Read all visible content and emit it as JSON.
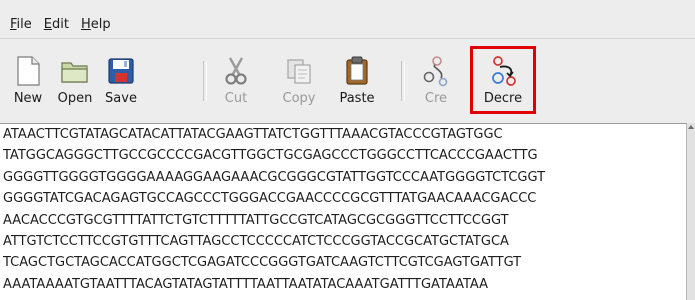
{
  "menu": {
    "file": {
      "mnemonic": "F",
      "rest": "ile"
    },
    "edit": {
      "mnemonic": "E",
      "rest": "dit"
    },
    "help": {
      "mnemonic": "H",
      "rest": "elp"
    }
  },
  "toolbar": {
    "buttons": [
      {
        "label": "New",
        "icon": "new-document-icon",
        "enabled": true
      },
      {
        "label": "Open",
        "icon": "open-folder-icon",
        "enabled": true
      },
      {
        "label": "Save",
        "icon": "floppy-disk-icon",
        "enabled": true
      },
      {
        "label": "Cut",
        "icon": "scissors-icon",
        "enabled": false
      },
      {
        "label": "Copy",
        "icon": "copy-pages-icon",
        "enabled": false
      },
      {
        "label": "Paste",
        "icon": "clipboard-icon",
        "enabled": true
      },
      {
        "label": "Cre",
        "icon": "circles-connect-icon",
        "enabled": false
      },
      {
        "label": "Decre",
        "icon": "circles-arrow-icon",
        "enabled": true,
        "highlighted": true
      }
    ]
  },
  "colors": {
    "highlight": "#e00000",
    "accent_blue": "#3a7bd5",
    "accent_red": "#d23232"
  },
  "sequence": {
    "lines": [
      "ATAACTTCGTATAGCATACATTATACGAAGTTATCTGGTTTAAACGTACCCGTAGTGGC",
      "TATGGCAGGGCTTGCCGCCCCGACGTTGGCTGCGAGCCCTGGGCCTTCACCCGAACTTG",
      "GGGGTTGGGGTGGGGAAAAGGAAGAAACGCGGGCGTATTGGTCCCAATGGGGTCTCGGT",
      "GGGGTATCGACAGAGTGCCAGCCCTGGGACCGAACCCCGCGTTTATGAACAAACGACCC",
      "AACACCCGTGCGTTTTATTCTGTCTTTTTATTGCCGTCATAGCGCGGGTTCCTTCCGGT",
      "ATTGTCTCCTTCCGTGTTTCAGTTAGCCTCCCCCATCTCCCGGTACCGCATGCTATGCA",
      "TCAGCTGCTAGCACCATGGCTCGAGATCCCGGGTGATCAAGTCTTCGTCGAGTGATTGT",
      "AAATAAAATGTAATTTACAGTATAGTATTTTAATTAATATACAAATGATTTGATAATAA"
    ]
  }
}
